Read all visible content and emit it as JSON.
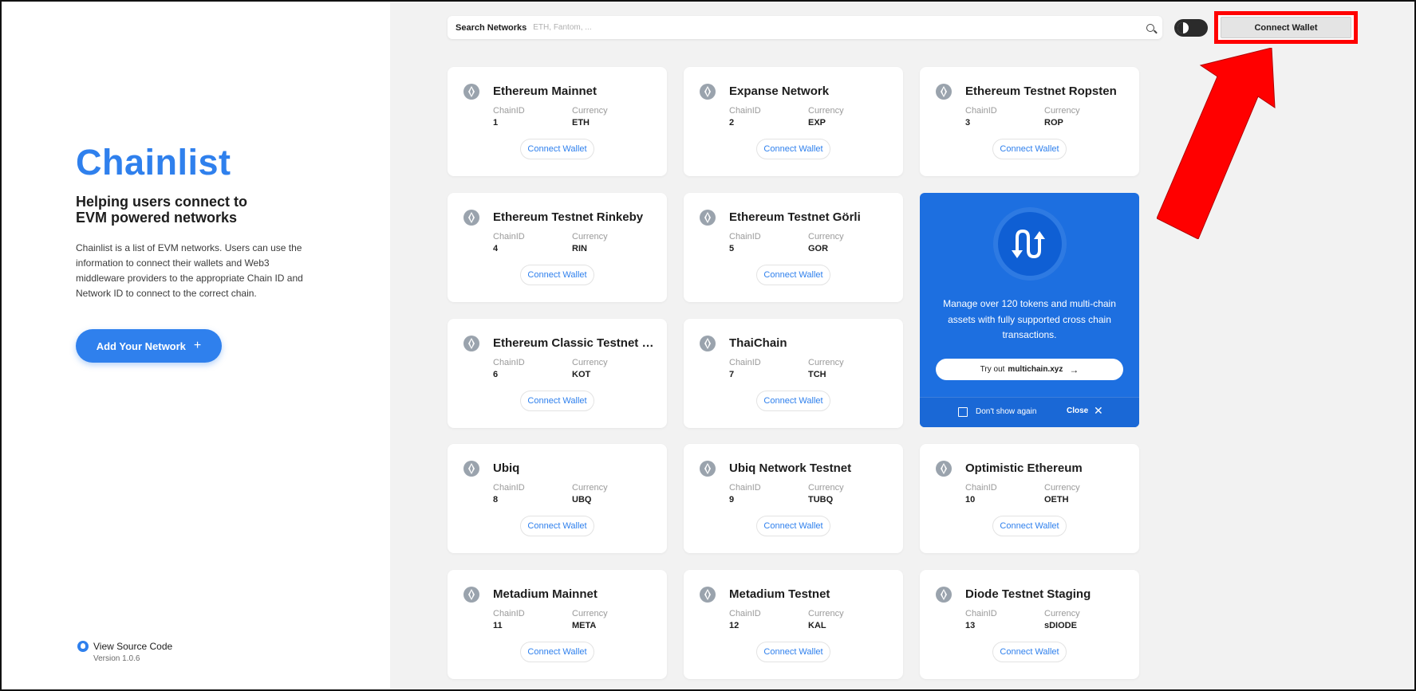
{
  "sidebar": {
    "title": "Chainlist",
    "subtitle_line1": "Helping users connect to",
    "subtitle_line2": "EVM powered networks",
    "description": "Chainlist is a list of EVM networks. Users can use the information to connect their wallets and Web3 middleware providers to the appropriate Chain ID and Network ID to connect to the correct chain.",
    "add_network_label": "Add Your Network",
    "add_network_icon": "+",
    "source_code_label": "View Source Code",
    "version": "Version 1.0.6"
  },
  "header": {
    "search_label": "Search Networks",
    "search_placeholder": "ETH, Fantom, ...",
    "connect_wallet_label": "Connect Wallet"
  },
  "labels": {
    "chain_id": "ChainID",
    "currency": "Currency",
    "connect_wallet": "Connect Wallet"
  },
  "networks": [
    {
      "name": "Ethereum Mainnet",
      "chain_id": "1",
      "currency": "ETH"
    },
    {
      "name": "Expanse Network",
      "chain_id": "2",
      "currency": "EXP"
    },
    {
      "name": "Ethereum Testnet Ropsten",
      "chain_id": "3",
      "currency": "ROP"
    },
    {
      "name": "Ethereum Testnet Rinkeby",
      "chain_id": "4",
      "currency": "RIN"
    },
    {
      "name": "Ethereum Testnet Görli",
      "chain_id": "5",
      "currency": "GOR"
    },
    {
      "name": "Ethereum Classic Testnet K...",
      "chain_id": "6",
      "currency": "KOT"
    },
    {
      "name": "ThaiChain",
      "chain_id": "7",
      "currency": "TCH"
    },
    {
      "name": "Ubiq",
      "chain_id": "8",
      "currency": "UBQ"
    },
    {
      "name": "Ubiq Network Testnet",
      "chain_id": "9",
      "currency": "TUBQ"
    },
    {
      "name": "Optimistic Ethereum",
      "chain_id": "10",
      "currency": "OETH"
    },
    {
      "name": "Metadium Mainnet",
      "chain_id": "11",
      "currency": "META"
    },
    {
      "name": "Metadium Testnet",
      "chain_id": "12",
      "currency": "KAL"
    },
    {
      "name": "Diode Testnet Staging",
      "chain_id": "13",
      "currency": "sDIODE"
    }
  ],
  "promo": {
    "text": "Manage over 120 tokens and multi-chain assets with fully supported cross chain transactions.",
    "try_prefix": "Try out",
    "try_link": "multichain.xyz",
    "dont_show": "Don't show again",
    "close": "Close"
  },
  "colors": {
    "accent": "#2f80ed",
    "promo_bg": "#1d6fe0",
    "highlight": "#ff0000"
  }
}
